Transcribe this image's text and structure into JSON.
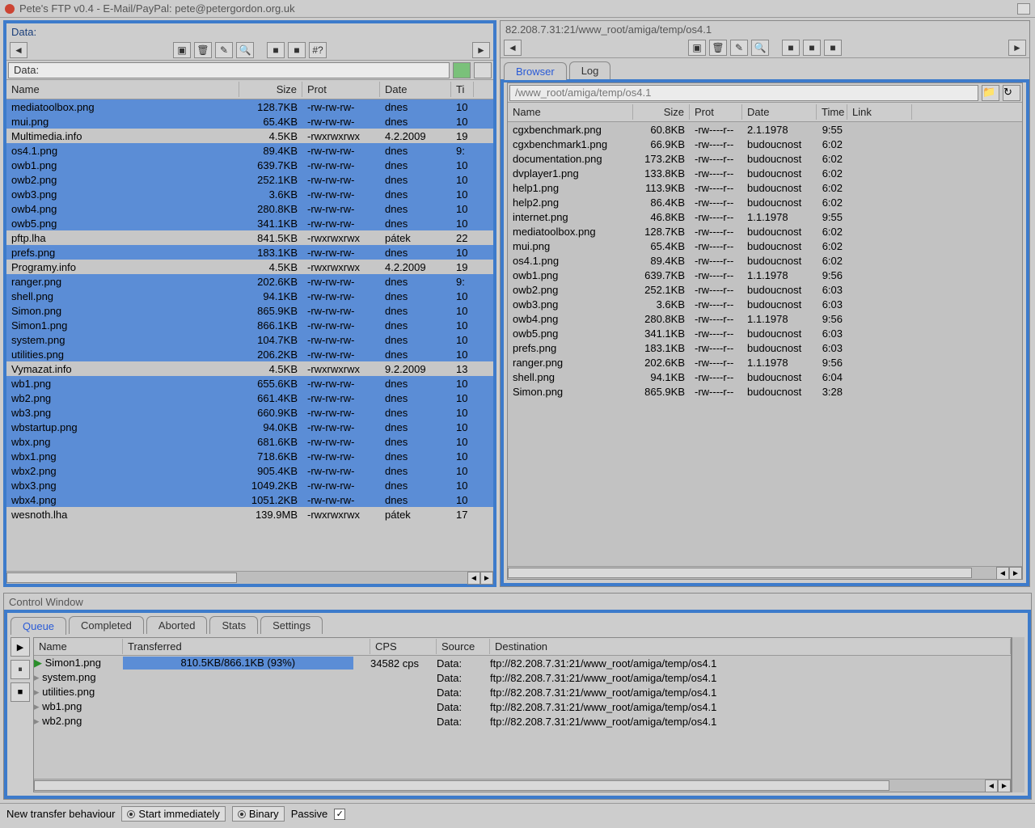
{
  "window": {
    "title": "Pete's FTP v0.4 - E-Mail/PayPal: pete@petergordon.org.uk"
  },
  "left": {
    "title": "Data:",
    "path": "Data:",
    "headers": [
      "Name",
      "Size",
      "Prot",
      "Date",
      "Ti"
    ],
    "rows": [
      {
        "name": "mediatoolbox.png",
        "size": "128.7KB",
        "prot": "-rw-rw-rw-",
        "date": "dnes",
        "time": "10",
        "sel": true
      },
      {
        "name": "mui.png",
        "size": "65.4KB",
        "prot": "-rw-rw-rw-",
        "date": "dnes",
        "time": "10",
        "sel": true
      },
      {
        "name": "Multimedia.info",
        "size": "4.5KB",
        "prot": "-rwxrwxrwx",
        "date": "4.2.2009",
        "time": "19",
        "sel": false
      },
      {
        "name": "os4.1.png",
        "size": "89.4KB",
        "prot": "-rw-rw-rw-",
        "date": "dnes",
        "time": "9:",
        "sel": true
      },
      {
        "name": "owb1.png",
        "size": "639.7KB",
        "prot": "-rw-rw-rw-",
        "date": "dnes",
        "time": "10",
        "sel": true
      },
      {
        "name": "owb2.png",
        "size": "252.1KB",
        "prot": "-rw-rw-rw-",
        "date": "dnes",
        "time": "10",
        "sel": true
      },
      {
        "name": "owb3.png",
        "size": "3.6KB",
        "prot": "-rw-rw-rw-",
        "date": "dnes",
        "time": "10",
        "sel": true
      },
      {
        "name": "owb4.png",
        "size": "280.8KB",
        "prot": "-rw-rw-rw-",
        "date": "dnes",
        "time": "10",
        "sel": true
      },
      {
        "name": "owb5.png",
        "size": "341.1KB",
        "prot": "-rw-rw-rw-",
        "date": "dnes",
        "time": "10",
        "sel": true
      },
      {
        "name": "pftp.lha",
        "size": "841.5KB",
        "prot": "-rwxrwxrwx",
        "date": "pátek",
        "time": "22",
        "sel": false
      },
      {
        "name": "prefs.png",
        "size": "183.1KB",
        "prot": "-rw-rw-rw-",
        "date": "dnes",
        "time": "10",
        "sel": true
      },
      {
        "name": "Programy.info",
        "size": "4.5KB",
        "prot": "-rwxrwxrwx",
        "date": "4.2.2009",
        "time": "19",
        "sel": false
      },
      {
        "name": "ranger.png",
        "size": "202.6KB",
        "prot": "-rw-rw-rw-",
        "date": "dnes",
        "time": "9:",
        "sel": true
      },
      {
        "name": "shell.png",
        "size": "94.1KB",
        "prot": "-rw-rw-rw-",
        "date": "dnes",
        "time": "10",
        "sel": true
      },
      {
        "name": "Simon.png",
        "size": "865.9KB",
        "prot": "-rw-rw-rw-",
        "date": "dnes",
        "time": "10",
        "sel": true
      },
      {
        "name": "Simon1.png",
        "size": "866.1KB",
        "prot": "-rw-rw-rw-",
        "date": "dnes",
        "time": "10",
        "sel": true
      },
      {
        "name": "system.png",
        "size": "104.7KB",
        "prot": "-rw-rw-rw-",
        "date": "dnes",
        "time": "10",
        "sel": true
      },
      {
        "name": "utilities.png",
        "size": "206.2KB",
        "prot": "-rw-rw-rw-",
        "date": "dnes",
        "time": "10",
        "sel": true
      },
      {
        "name": "Vymazat.info",
        "size": "4.5KB",
        "prot": "-rwxrwxrwx",
        "date": "9.2.2009",
        "time": "13",
        "sel": false
      },
      {
        "name": "wb1.png",
        "size": "655.6KB",
        "prot": "-rw-rw-rw-",
        "date": "dnes",
        "time": "10",
        "sel": true
      },
      {
        "name": "wb2.png",
        "size": "661.4KB",
        "prot": "-rw-rw-rw-",
        "date": "dnes",
        "time": "10",
        "sel": true
      },
      {
        "name": "wb3.png",
        "size": "660.9KB",
        "prot": "-rw-rw-rw-",
        "date": "dnes",
        "time": "10",
        "sel": true
      },
      {
        "name": "wbstartup.png",
        "size": "94.0KB",
        "prot": "-rw-rw-rw-",
        "date": "dnes",
        "time": "10",
        "sel": true
      },
      {
        "name": "wbx.png",
        "size": "681.6KB",
        "prot": "-rw-rw-rw-",
        "date": "dnes",
        "time": "10",
        "sel": true
      },
      {
        "name": "wbx1.png",
        "size": "718.6KB",
        "prot": "-rw-rw-rw-",
        "date": "dnes",
        "time": "10",
        "sel": true
      },
      {
        "name": "wbx2.png",
        "size": "905.4KB",
        "prot": "-rw-rw-rw-",
        "date": "dnes",
        "time": "10",
        "sel": true
      },
      {
        "name": "wbx3.png",
        "size": "1049.2KB",
        "prot": "-rw-rw-rw-",
        "date": "dnes",
        "time": "10",
        "sel": true
      },
      {
        "name": "wbx4.png",
        "size": "1051.2KB",
        "prot": "-rw-rw-rw-",
        "date": "dnes",
        "time": "10",
        "sel": true
      },
      {
        "name": "wesnoth.lha",
        "size": "139.9MB",
        "prot": "-rwxrwxrwx",
        "date": "pátek",
        "time": "17",
        "sel": false
      }
    ]
  },
  "right": {
    "title": "82.208.7.31:21/www_root/amiga/temp/os4.1",
    "path": "/www_root/amiga/temp/os4.1",
    "tabs": [
      "Browser",
      "Log"
    ],
    "activeTab": 0,
    "headers": [
      "Name",
      "Size",
      "Prot",
      "Date",
      "Time",
      "Link"
    ],
    "rows": [
      {
        "name": "cgxbenchmark.png",
        "size": "60.8KB",
        "prot": "-rw----r--",
        "date": "2.1.1978",
        "time": "9:55"
      },
      {
        "name": "cgxbenchmark1.png",
        "size": "66.9KB",
        "prot": "-rw----r--",
        "date": "budoucnost",
        "time": "6:02"
      },
      {
        "name": "documentation.png",
        "size": "173.2KB",
        "prot": "-rw----r--",
        "date": "budoucnost",
        "time": "6:02"
      },
      {
        "name": "dvplayer1.png",
        "size": "133.8KB",
        "prot": "-rw----r--",
        "date": "budoucnost",
        "time": "6:02"
      },
      {
        "name": "help1.png",
        "size": "113.9KB",
        "prot": "-rw----r--",
        "date": "budoucnost",
        "time": "6:02"
      },
      {
        "name": "help2.png",
        "size": "86.4KB",
        "prot": "-rw----r--",
        "date": "budoucnost",
        "time": "6:02"
      },
      {
        "name": "internet.png",
        "size": "46.8KB",
        "prot": "-rw----r--",
        "date": "1.1.1978",
        "time": "9:55"
      },
      {
        "name": "mediatoolbox.png",
        "size": "128.7KB",
        "prot": "-rw----r--",
        "date": "budoucnost",
        "time": "6:02"
      },
      {
        "name": "mui.png",
        "size": "65.4KB",
        "prot": "-rw----r--",
        "date": "budoucnost",
        "time": "6:02"
      },
      {
        "name": "os4.1.png",
        "size": "89.4KB",
        "prot": "-rw----r--",
        "date": "budoucnost",
        "time": "6:02"
      },
      {
        "name": "owb1.png",
        "size": "639.7KB",
        "prot": "-rw----r--",
        "date": "1.1.1978",
        "time": "9:56"
      },
      {
        "name": "owb2.png",
        "size": "252.1KB",
        "prot": "-rw----r--",
        "date": "budoucnost",
        "time": "6:03"
      },
      {
        "name": "owb3.png",
        "size": "3.6KB",
        "prot": "-rw----r--",
        "date": "budoucnost",
        "time": "6:03"
      },
      {
        "name": "owb4.png",
        "size": "280.8KB",
        "prot": "-rw----r--",
        "date": "1.1.1978",
        "time": "9:56"
      },
      {
        "name": "owb5.png",
        "size": "341.1KB",
        "prot": "-rw----r--",
        "date": "budoucnost",
        "time": "6:03"
      },
      {
        "name": "prefs.png",
        "size": "183.1KB",
        "prot": "-rw----r--",
        "date": "budoucnost",
        "time": "6:03"
      },
      {
        "name": "ranger.png",
        "size": "202.6KB",
        "prot": "-rw----r--",
        "date": "1.1.1978",
        "time": "9:56"
      },
      {
        "name": "shell.png",
        "size": "94.1KB",
        "prot": "-rw----r--",
        "date": "budoucnost",
        "time": "6:04"
      },
      {
        "name": "Simon.png",
        "size": "865.9KB",
        "prot": "-rw----r--",
        "date": "budoucnost",
        "time": "3:28"
      }
    ]
  },
  "control": {
    "title": "Control Window",
    "tabs": [
      "Queue",
      "Completed",
      "Aborted",
      "Stats",
      "Settings"
    ],
    "activeTab": 0,
    "headers": [
      "Name",
      "Transferred",
      "CPS",
      "Source",
      "Destination"
    ],
    "rows": [
      {
        "name": "Simon1.png",
        "trans": "810.5KB/866.1KB (93%)",
        "cps": "34582 cps",
        "src": "Data:",
        "dest": "ftp://82.208.7.31:21/www_root/amiga/temp/os4.1",
        "prog": 93,
        "active": true
      },
      {
        "name": "system.png",
        "trans": "",
        "cps": "",
        "src": "Data:",
        "dest": "ftp://82.208.7.31:21/www_root/amiga/temp/os4.1",
        "prog": 0
      },
      {
        "name": "utilities.png",
        "trans": "",
        "cps": "",
        "src": "Data:",
        "dest": "ftp://82.208.7.31:21/www_root/amiga/temp/os4.1",
        "prog": 0
      },
      {
        "name": "wb1.png",
        "trans": "",
        "cps": "",
        "src": "Data:",
        "dest": "ftp://82.208.7.31:21/www_root/amiga/temp/os4.1",
        "prog": 0
      },
      {
        "name": "wb2.png",
        "trans": "",
        "cps": "",
        "src": "Data:",
        "dest": "ftp://82.208.7.31:21/www_root/amiga/temp/os4.1",
        "prog": 0
      }
    ]
  },
  "footer": {
    "label": "New transfer behaviour",
    "opt1": "Start immediately",
    "opt2": "Binary",
    "opt3": "Passive"
  }
}
